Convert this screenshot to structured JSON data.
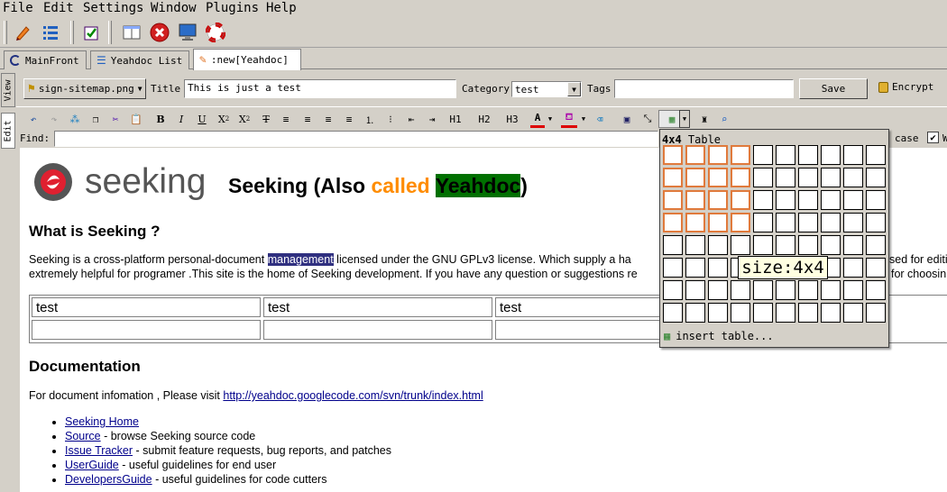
{
  "menu": [
    "File",
    "Edit",
    "Settings",
    "Window",
    "Plugins",
    "Help"
  ],
  "toolbar": {
    "icons": [
      "pencil-icon",
      "list-icon",
      "checklist-icon",
      "window-icon",
      "stop-icon",
      "monitor-icon",
      "lifebuoy-icon"
    ]
  },
  "tabs": [
    {
      "label": "MainFront"
    },
    {
      "label": "Yeahdoc List"
    },
    {
      "label": ":new[Yeahdoc]"
    }
  ],
  "side_tabs": [
    "View",
    "Edit"
  ],
  "form": {
    "template_button": "sign-sitemap.png",
    "title_label": "Title",
    "title_value": "This is just a test",
    "category_label": "Category",
    "category_value": "test",
    "tags_label": "Tags",
    "tags_value": "",
    "save_label": "Save",
    "encrypt_label": "Encrypt"
  },
  "editor_toolbar": {
    "h1": "H1",
    "h2": "H2",
    "h3": "H3",
    "bold": "B",
    "italic": "I",
    "underline": "U",
    "sub": "X",
    "sub_mark": "2",
    "sup": "X",
    "sup_mark": "2"
  },
  "find": {
    "label": "Find:",
    "value": "",
    "case_label": "case",
    "checkbox_extra": "W"
  },
  "doc": {
    "logo_text": "seeking",
    "heading_prefix": "Seeking (Also ",
    "heading_called": "called",
    "heading_space": " ",
    "heading_highlight": "Yeahdoc",
    "heading_suffix": ")",
    "what_heading": "What is Seeking ?",
    "para_line1_a": "Seeking is a cross-platform personal-document ",
    "para_line1_sel": "management",
    "para_line1_b": " licensed under the GNU GPLv3 license. Which supply a ha",
    "para_line1_c": "sed for editi",
    "para_line2": "extremely helpful for programer .This site is the home of Seeking development. If you have any question or suggestions re",
    "para_line2_c": "for choosin",
    "table": [
      [
        "test",
        "test",
        "test"
      ],
      [
        "",
        "",
        ""
      ]
    ],
    "doc_heading": "Documentation",
    "doc_text": "For document infomation , Please visit ",
    "doc_link": "http://yeahdoc.googlecode.com/svn/trunk/index.html",
    "list": [
      {
        "link": "Seeking Home",
        "text": ""
      },
      {
        "link": "Source",
        "text": " - browse Seeking source code"
      },
      {
        "link": "Issue Tracker",
        "text": " - submit feature requests, bug reports, and patches"
      },
      {
        "link": "UserGuide",
        "text": " - useful guidelines for end user"
      },
      {
        "link": "DevelopersGuide",
        "text": " - useful guidelines for code cutters"
      }
    ]
  },
  "table_popup": {
    "size_bold": "4x4",
    "size_label": " Table",
    "grid_cols": 10,
    "grid_rows": 8,
    "selected_cols": 4,
    "selected_rows": 4,
    "insert_label": "insert table...",
    "tooltip": "size:4x4"
  },
  "colors": {
    "accent_orange": "#ff8c00",
    "highlight_green": "#007000",
    "selection_blue": "#303080",
    "grid_select": "#e07a3c"
  }
}
